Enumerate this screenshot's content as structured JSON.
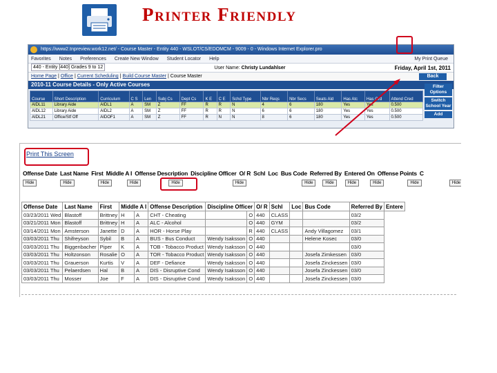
{
  "slide": {
    "title": "Printer Friendly"
  },
  "browser": {
    "title": "https://www2.tnpreview.work12.net/ - Course Master - Entity 440 - WSLOT/CS/EDOMCM - 9009 - 0 - Windows Internet Explorer.pro",
    "toolbar": [
      "Favorites",
      "Notes",
      "Preferences",
      "Create New Window",
      "Student Locator",
      "Help"
    ],
    "entity_select": "440 - Entity [440] Grades 9 to 12",
    "user_label": "User Name:",
    "user_name": "Christy Lundahlser",
    "queue_link": "My Print Queue",
    "date": "Friday, April 1st, 2011",
    "nav": [
      "Home Page",
      "Office",
      "Current Scheduling",
      "Build Course Master",
      "Course Master"
    ],
    "back": "Back",
    "header": "2010-11 Course Details - Only Active Courses",
    "side_buttons": [
      "Filter Options",
      "Switch School Year",
      "Add"
    ],
    "columns": [
      "Course",
      "Short Description",
      "Curriculum",
      "C S",
      "Len",
      "Subj Cs",
      "Dept Cs",
      "K E",
      "C E",
      "Schd Type",
      "Nbr Reqs",
      "Nbr Secs",
      "Seats Ald",
      "Has Atc",
      "Has Grd",
      "Attend Cred"
    ],
    "rows": [
      [
        "AIDL11",
        "Library Aide",
        "AIDL1",
        "A",
        "SM",
        "Z",
        "FF",
        "R",
        "R",
        "N",
        "4",
        "6",
        "180",
        "Yes",
        "Yes",
        "0.500"
      ],
      [
        "AIDL12",
        "Library Aide",
        "AIDL2",
        "A",
        "SM",
        "Z",
        "FF",
        "R",
        "R",
        "N",
        "6",
        "6",
        "180",
        "Yes",
        "Yes",
        "0.500"
      ],
      [
        "AIDL21",
        "Office/Stf Off",
        "AIDOF1",
        "A",
        "SM",
        "Z",
        "FF",
        "R",
        "N",
        "N",
        "8",
        "6",
        "180",
        "Yes",
        "Yes",
        "0.500"
      ]
    ]
  },
  "incidents": {
    "print_link": "Print This Screen",
    "filter_header": [
      "Offense Date",
      "Last Name",
      "First",
      "Middle A I",
      "Offense Description",
      "Discipline Officer",
      "O/ R",
      "Schl",
      "Loc",
      "Bus Code",
      "Referred By",
      "Entered On",
      "Offense Points",
      "C"
    ],
    "filter_buttons": [
      "Hide",
      "Hide",
      "Hide",
      "Hide",
      "Hide",
      "Hide",
      "Hide",
      "Hide",
      "Hide",
      "Hide",
      "Hide",
      "Hide",
      "Hide",
      "Hide"
    ],
    "columns": [
      "Offense Date",
      "Last Name",
      "First",
      "Middle A I",
      "Offense Description",
      "Discipline Officer",
      "O/ R",
      "Schl",
      "Loc",
      "Bus Code",
      "Referred By",
      "Entere"
    ],
    "rows": [
      [
        "03/23/2011 Wed",
        "Blastoff",
        "Brittney",
        "H",
        "A",
        "CHT - Cheating",
        "",
        "O",
        "440",
        "CLASS",
        "",
        "",
        "03/2"
      ],
      [
        "03/21/2011 Mon",
        "Blastoff",
        "Brittney",
        "H",
        "A",
        "ALC - Alcohol",
        "",
        "O",
        "440",
        "GYM",
        "",
        "",
        "03/2"
      ],
      [
        "03/14/2011 Mon",
        "Amsterson",
        "Janette",
        "D",
        "A",
        "HOR - Horse Play",
        "",
        "R",
        "440",
        "CLASS",
        "",
        "Andy Villagomez",
        "03/1"
      ],
      [
        "03/03/2011 Thu",
        "Shifreyson",
        "Sybil",
        "B",
        "A",
        "BUS - Bus Conduct",
        "Wendy Isaksson",
        "O",
        "440",
        "",
        "",
        "Helene Kosec",
        "03/0"
      ],
      [
        "03/03/2011 Thu",
        "Biggenbacher",
        "Piper",
        "K",
        "A",
        "TOB - Tobacco Product",
        "Wendy Isaksson",
        "O",
        "440",
        "",
        "",
        "",
        "03/0"
      ],
      [
        "03/03/2011 Thu",
        "Holtzonson",
        "Rosalie",
        "O",
        "A",
        "TOR - Tobacco Product",
        "Wendy Isaksson",
        "O",
        "440",
        "",
        "",
        "Josefa Zimkessen",
        "03/0"
      ],
      [
        "03/03/2011 Thu",
        "Grauerson",
        "Kurtis",
        "V",
        "A",
        "DEF - Defiance",
        "Wendy Isaksson",
        "O",
        "440",
        "",
        "",
        "Josefa Zinckessen",
        "03/0"
      ],
      [
        "03/03/2011 Thu",
        "Pelaerdsen",
        "Hal",
        "B",
        "A",
        "DIS - Disruptive Cond",
        "Wendy Isaksson",
        "O",
        "440",
        "",
        "",
        "Josefa Zinckessen",
        "03/0"
      ],
      [
        "03/03/2011 Thu",
        "Mosser",
        "Joe",
        "F",
        "A",
        "DIS - Disruptive Cond",
        "Wendy Isaksson",
        "O",
        "440",
        "",
        "",
        "Josefa Zinckessen",
        "03/0"
      ]
    ]
  },
  "icons": {
    "printer": "printer-icon"
  },
  "colors": {
    "accent_red": "#c00000",
    "highlight_red": "#d0021b",
    "nav_blue": "#1f4f93"
  }
}
